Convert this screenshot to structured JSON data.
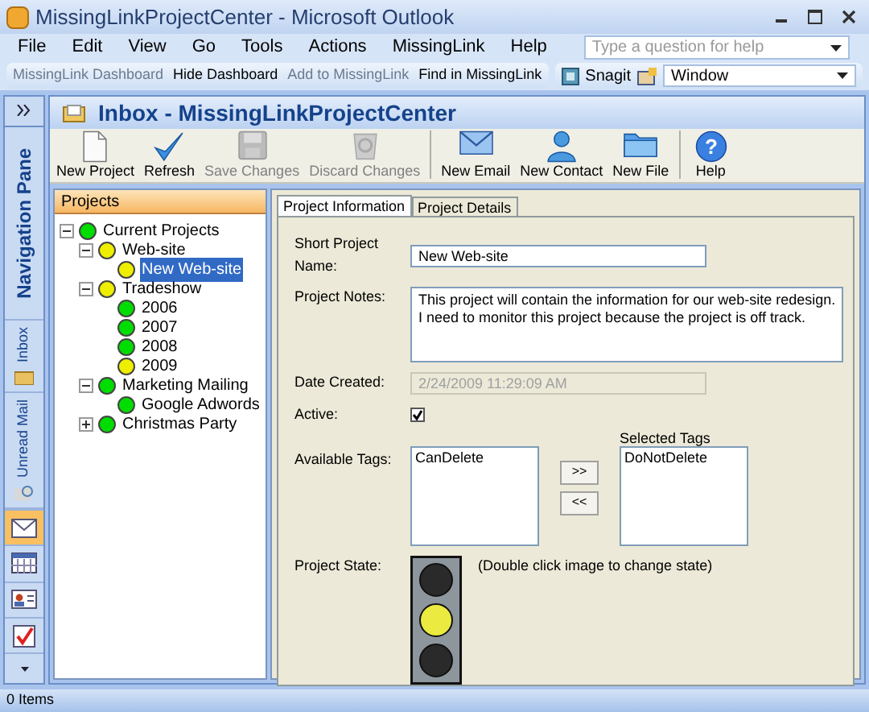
{
  "window": {
    "title": "MissingLinkProjectCenter - Microsoft Outlook"
  },
  "menu": [
    "File",
    "Edit",
    "View",
    "Go",
    "Tools",
    "Actions",
    "MissingLink",
    "Help"
  ],
  "help_search": {
    "placeholder": "Type a question for help"
  },
  "toolbar": [
    {
      "label": "MissingLink Dashboard",
      "disabled": true
    },
    {
      "label": "Hide Dashboard",
      "disabled": false
    },
    {
      "label": "Add to MissingLink",
      "disabled": true
    },
    {
      "label": "Find in MissingLink",
      "disabled": false
    }
  ],
  "snagit": {
    "label": "Snagit",
    "dropdown": "Window"
  },
  "navigation_pane": {
    "title": "Navigation Pane",
    "shortcuts": [
      "Inbox",
      "Unread Mail"
    ]
  },
  "folder_title": "Inbox - MissingLinkProjectCenter",
  "actions": [
    {
      "label": "New Project",
      "disabled": false,
      "kind": "page"
    },
    {
      "label": "Refresh",
      "disabled": false,
      "kind": "check"
    },
    {
      "label": "Save Changes",
      "disabled": true,
      "kind": "disk"
    },
    {
      "label": "Discard Changes",
      "disabled": true,
      "kind": "bin"
    },
    {
      "label": "New Email",
      "disabled": false,
      "kind": "mail"
    },
    {
      "label": "New Contact",
      "disabled": false,
      "kind": "person"
    },
    {
      "label": "New File",
      "disabled": false,
      "kind": "folder"
    },
    {
      "label": "Help",
      "disabled": false,
      "kind": "help",
      "glyph": "?"
    }
  ],
  "projects": {
    "title": "Projects",
    "tree": [
      {
        "label": "Current Projects",
        "color": "#00dd00",
        "expanded": true,
        "selected": false,
        "children": [
          {
            "label": "Web-site",
            "color": "#eeee00",
            "expanded": true,
            "selected": false,
            "children": [
              {
                "label": "New Web-site",
                "color": "#eeee00",
                "selected": true
              }
            ]
          },
          {
            "label": "Tradeshow",
            "color": "#eeee00",
            "expanded": true,
            "selected": false,
            "children": [
              {
                "label": "2006",
                "color": "#00dd00",
                "selected": false
              },
              {
                "label": "2007",
                "color": "#00dd00",
                "selected": false
              },
              {
                "label": "2008",
                "color": "#00dd00",
                "selected": false
              },
              {
                "label": "2009",
                "color": "#eeee00",
                "selected": false
              }
            ]
          },
          {
            "label": "Marketing Mailing",
            "color": "#00dd00",
            "expanded": true,
            "selected": false,
            "children": [
              {
                "label": "Google Adwords",
                "color": "#00dd00",
                "selected": false
              }
            ]
          },
          {
            "label": "Christmas Party",
            "color": "#00dd00",
            "expanded": false,
            "selected": false
          }
        ]
      }
    ]
  },
  "tabs": [
    {
      "label": "Project Information",
      "selected": true
    },
    {
      "label": "Project Details",
      "selected": false
    }
  ],
  "form": {
    "short_name": {
      "label": "Short Project Name:",
      "value": "New Web-site"
    },
    "notes": {
      "label": "Project Notes:",
      "lines": [
        "This project will contain the information for our web-site redesign.",
        "I need to monitor this project because the project is off track."
      ]
    },
    "date_created": {
      "label": "Date Created:",
      "value": "2/24/2009 11:29:09 AM",
      "disabled": true
    },
    "active": {
      "label": "Active:",
      "checked": true
    },
    "available_tags": {
      "label": "Available Tags:",
      "items": [
        "CanDelete"
      ]
    },
    "selected_tags": {
      "label": "Selected Tags",
      "items": [
        "DoNotDelete"
      ]
    },
    "move_buttons": [
      ">>",
      "<<"
    ],
    "project_state": {
      "label": "Project State:",
      "hint": "(Double click image to change state)",
      "lights": [
        {
          "lit": false
        },
        {
          "lit": true
        },
        {
          "lit": false
        }
      ]
    }
  },
  "status_bar": "0 Items"
}
